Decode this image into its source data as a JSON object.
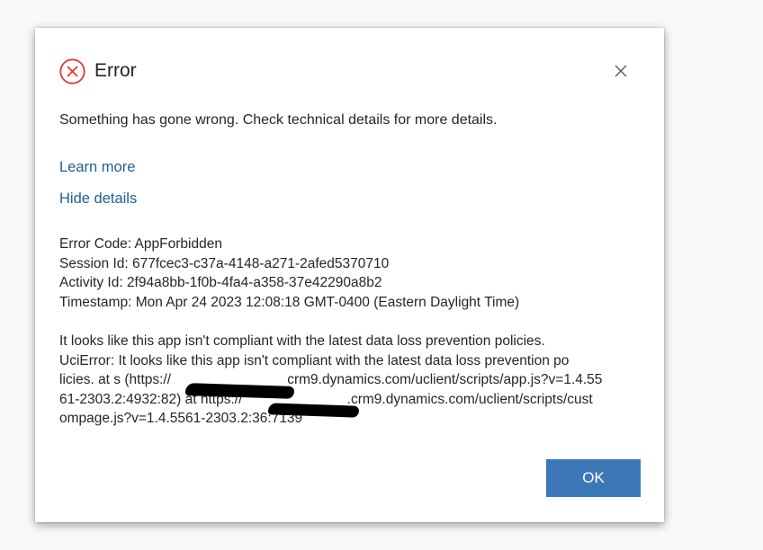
{
  "dialog": {
    "title": "Error",
    "message": "Something has gone wrong. Check technical details for more details.",
    "learn_more": "Learn more",
    "hide_details": "Hide details",
    "ok_label": "OK",
    "icons": {
      "error": "error-circle-icon",
      "close": "close-icon"
    },
    "colors": {
      "error_icon": "#e03a35",
      "link": "#1f5f96",
      "ok_button": "#3c78b8"
    }
  },
  "details": {
    "error_code": "Error Code: AppForbidden",
    "session_id": "Session Id: 677fcec3-c37a-4148-a271-2afed5370710",
    "activity_id": "Activity Id: 2f94a8bb-1f0b-4fa4-a358-37e42290a8b2",
    "timestamp": "Timestamp: Mon Apr 24 2023 12:08:18 GMT-0400 (Eastern Daylight Time)",
    "stack_lines": [
      "It looks like this app isn't compliant with the latest data loss prevention policies.",
      "UciError: It looks like this app isn't compliant with the latest data loss prevention po",
      "licies. at s (https://                              crm9.dynamics.com/uclient/scripts/app.js?v=1.4.55",
      "61-2303.2:4932:82) at https://                           .crm9.dynamics.com/uclient/scripts/cust",
      "ompage.js?v=1.4.5561-2303.2:36:7139"
    ]
  }
}
